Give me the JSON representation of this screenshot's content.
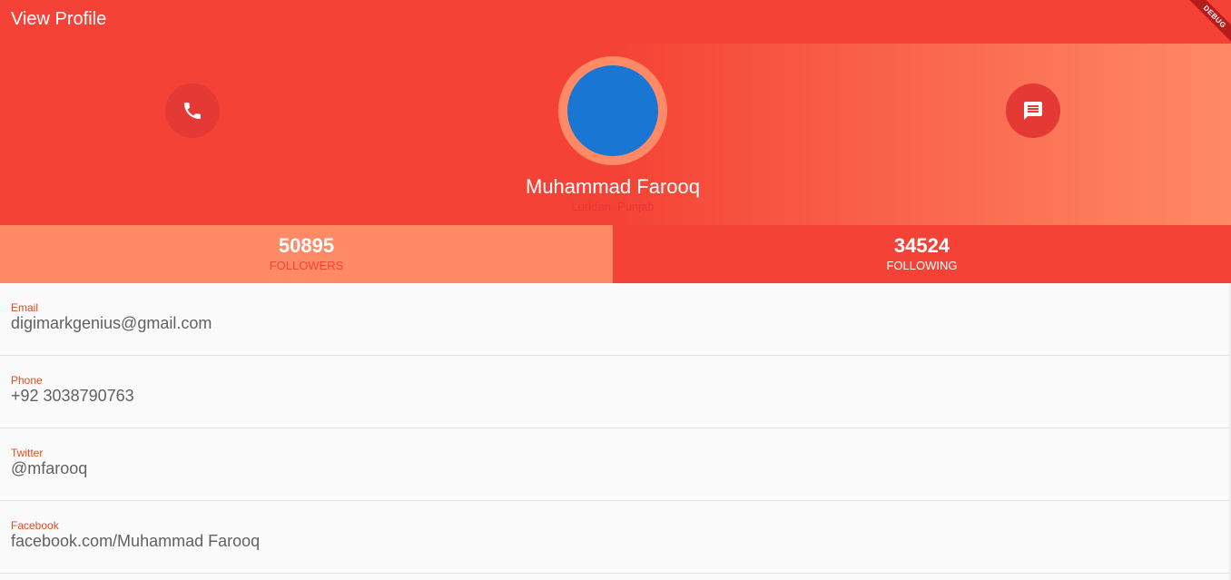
{
  "appbar": {
    "title": "View Profile"
  },
  "debug_banner": "DEBUG",
  "header": {
    "call_icon": "phone-icon",
    "message_icon": "message-icon",
    "name": "Muhammad Farooq",
    "location": "Luddan, Punjab"
  },
  "stats": {
    "followers": {
      "value": "50895",
      "label": "FOLLOWERS"
    },
    "following": {
      "value": "34524",
      "label": "FOLLOWING"
    }
  },
  "info": [
    {
      "label": "Email",
      "value": "digimarkgenius@gmail.com"
    },
    {
      "label": "Phone",
      "value": "+92 3038790763"
    },
    {
      "label": "Twitter",
      "value": "@mfarooq"
    },
    {
      "label": "Facebook",
      "value": "facebook.com/Muhammad Farooq"
    }
  ],
  "colors": {
    "primary": "#f44336",
    "accent": "#ff8a65",
    "avatar": "#1976d2",
    "label": "#e64a19"
  }
}
